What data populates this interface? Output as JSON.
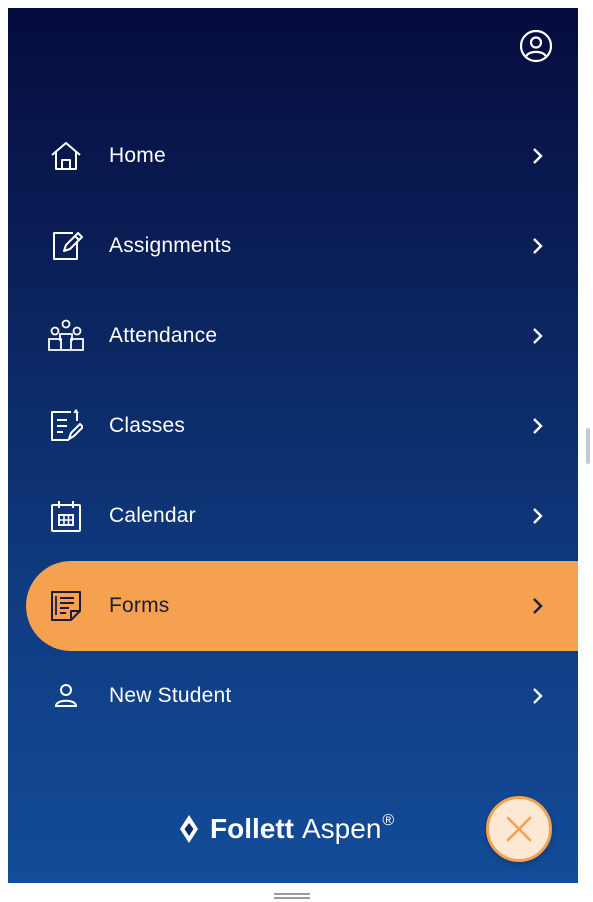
{
  "nav": {
    "items": [
      {
        "label": "Home",
        "icon": "home-icon",
        "active": false
      },
      {
        "label": "Assignments",
        "icon": "edit-note-icon",
        "active": false
      },
      {
        "label": "Attendance",
        "icon": "people-group-icon",
        "active": false
      },
      {
        "label": "Classes",
        "icon": "class-list-icon",
        "active": false
      },
      {
        "label": "Calendar",
        "icon": "calendar-icon",
        "active": false
      },
      {
        "label": "Forms",
        "icon": "form-icon",
        "active": true
      },
      {
        "label": "New Student",
        "icon": "person-icon",
        "active": false
      }
    ]
  },
  "brand": {
    "strong": "Follett",
    "light": "Aspen",
    "reg": "®"
  },
  "colors": {
    "panel_top": "#060b3e",
    "panel_bottom": "#134c99",
    "accent": "#f6a150",
    "text": "#ffffff",
    "active_text": "#1c1c3a"
  }
}
